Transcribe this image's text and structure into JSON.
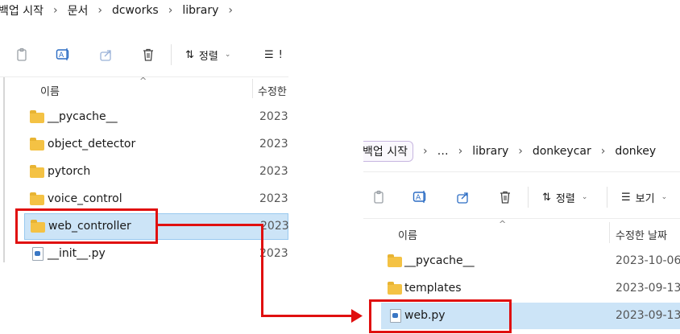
{
  "left_window": {
    "breadcrumb": [
      "백업 시작",
      "문서",
      "dcworks",
      "library"
    ],
    "toolbar": {
      "sort_label": "정렬",
      "view_label_partial": "!"
    },
    "columns": {
      "name": "이름",
      "date_partial": "수정한"
    },
    "items": [
      {
        "name": "__pycache__",
        "type": "folder",
        "date": "2023-"
      },
      {
        "name": "object_detector",
        "type": "folder",
        "date": "2023-"
      },
      {
        "name": "pytorch",
        "type": "folder",
        "date": "2023-"
      },
      {
        "name": "voice_control",
        "type": "folder",
        "date": "2023-"
      },
      {
        "name": "web_controller",
        "type": "folder",
        "date": "2023-",
        "selected": true
      },
      {
        "name": "__init__.py",
        "type": "py",
        "date": "2023-"
      }
    ]
  },
  "right_window": {
    "breadcrumb": [
      "백업 시작",
      "…",
      "library",
      "donkeycar",
      "donkey"
    ],
    "toolbar": {
      "sort_label": "정렬",
      "view_label": "보기"
    },
    "columns": {
      "name": "이름",
      "date": "수정한 날짜"
    },
    "items": [
      {
        "name": "__pycache__",
        "type": "folder",
        "date": "2023-10-06 ."
      },
      {
        "name": "templates",
        "type": "folder",
        "date": "2023-09-13 ."
      },
      {
        "name": "web.py",
        "type": "py",
        "date": "2023-09-13 .",
        "selected": true
      }
    ]
  },
  "colors": {
    "highlight": "#e01010",
    "selection": "#cce4f7",
    "folder": "#f4c244"
  }
}
